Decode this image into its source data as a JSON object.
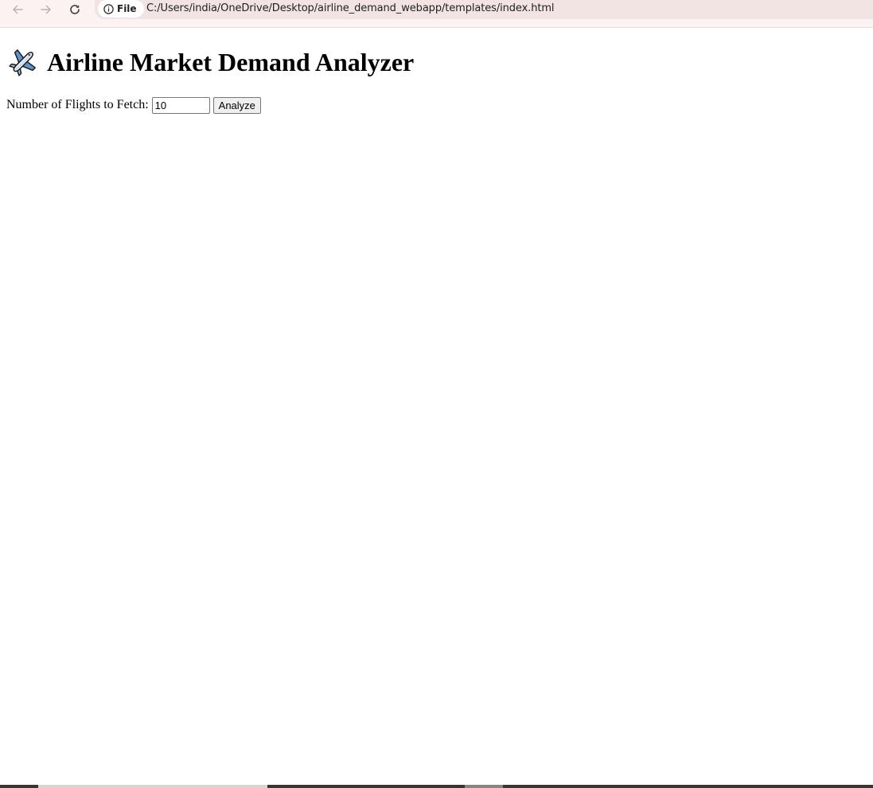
{
  "browser": {
    "chip_label": "File",
    "url": "C:/Users/india/OneDrive/Desktop/airline_demand_webapp/templates/index.html",
    "icons": {
      "back": "arrow-left-icon",
      "forward": "arrow-right-icon",
      "reload": "reload-icon",
      "info": "info-circle-icon"
    },
    "colors": {
      "toolbar_bg": "#fbf2f1",
      "omnibox_bg": "#f1e4e3"
    }
  },
  "page": {
    "title": "Airline Market Demand Analyzer",
    "title_icon": "airplane-icon",
    "form": {
      "label": "Number of Flights to Fetch:",
      "input_value": "10",
      "button_label": "Analyze"
    }
  }
}
